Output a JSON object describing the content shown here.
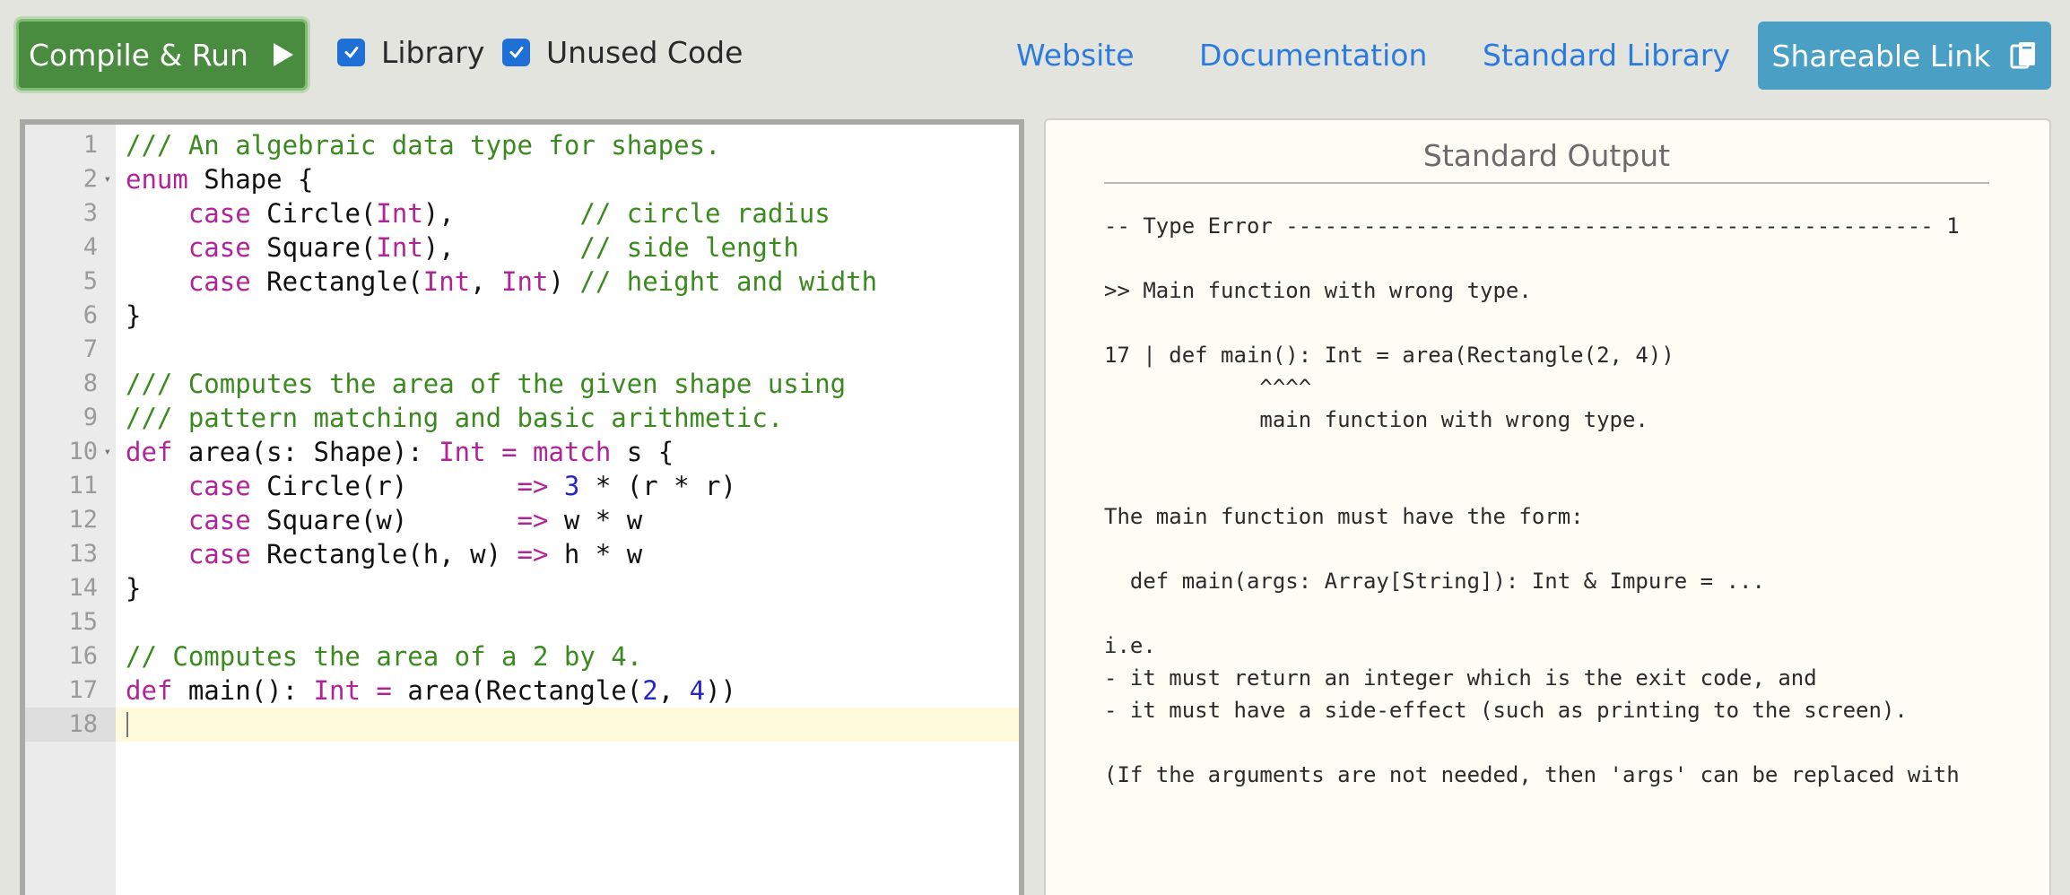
{
  "toolbar": {
    "run_label": "Compile & Run",
    "run_icon": "play-icon",
    "library_label": "Library",
    "library_checked": true,
    "unused_code_label": "Unused Code",
    "unused_code_checked": true,
    "links": [
      "Website",
      "Documentation",
      "Standard Library"
    ],
    "share_label": "Shareable Link",
    "share_icon": "clipboard-icon"
  },
  "editor": {
    "active_line": 18,
    "lines": [
      {
        "n": "1",
        "fold": false,
        "tokens": [
          {
            "t": "/// An algebraic data type for shapes.",
            "c": "comment"
          }
        ]
      },
      {
        "n": "2",
        "fold": true,
        "tokens": [
          {
            "t": "enum",
            "c": "keyword"
          },
          {
            "t": " Shape {",
            "c": "plain"
          }
        ]
      },
      {
        "n": "3",
        "fold": false,
        "tokens": [
          {
            "t": "    ",
            "c": "plain"
          },
          {
            "t": "case",
            "c": "keyword"
          },
          {
            "t": " Circle(",
            "c": "plain"
          },
          {
            "t": "Int",
            "c": "keyword"
          },
          {
            "t": "),        ",
            "c": "plain"
          },
          {
            "t": "// circle radius",
            "c": "comment"
          }
        ]
      },
      {
        "n": "4",
        "fold": false,
        "tokens": [
          {
            "t": "    ",
            "c": "plain"
          },
          {
            "t": "case",
            "c": "keyword"
          },
          {
            "t": " Square(",
            "c": "plain"
          },
          {
            "t": "Int",
            "c": "keyword"
          },
          {
            "t": "),        ",
            "c": "plain"
          },
          {
            "t": "// side length",
            "c": "comment"
          }
        ]
      },
      {
        "n": "5",
        "fold": false,
        "tokens": [
          {
            "t": "    ",
            "c": "plain"
          },
          {
            "t": "case",
            "c": "keyword"
          },
          {
            "t": " Rectangle(",
            "c": "plain"
          },
          {
            "t": "Int",
            "c": "keyword"
          },
          {
            "t": ", ",
            "c": "plain"
          },
          {
            "t": "Int",
            "c": "keyword"
          },
          {
            "t": ") ",
            "c": "plain"
          },
          {
            "t": "// height and width",
            "c": "comment"
          }
        ]
      },
      {
        "n": "6",
        "fold": false,
        "tokens": [
          {
            "t": "}",
            "c": "plain"
          }
        ]
      },
      {
        "n": "7",
        "fold": false,
        "tokens": []
      },
      {
        "n": "8",
        "fold": false,
        "tokens": [
          {
            "t": "/// Computes the area of the given shape using",
            "c": "comment"
          }
        ]
      },
      {
        "n": "9",
        "fold": false,
        "tokens": [
          {
            "t": "/// pattern matching and basic arithmetic.",
            "c": "comment"
          }
        ]
      },
      {
        "n": "10",
        "fold": true,
        "tokens": [
          {
            "t": "def",
            "c": "keyword"
          },
          {
            "t": " area(s: Shape): ",
            "c": "plain"
          },
          {
            "t": "Int",
            "c": "keyword"
          },
          {
            "t": " ",
            "c": "plain"
          },
          {
            "t": "=",
            "c": "keyword"
          },
          {
            "t": " ",
            "c": "plain"
          },
          {
            "t": "match",
            "c": "keyword"
          },
          {
            "t": " s {",
            "c": "plain"
          }
        ]
      },
      {
        "n": "11",
        "fold": false,
        "tokens": [
          {
            "t": "    ",
            "c": "plain"
          },
          {
            "t": "case",
            "c": "keyword"
          },
          {
            "t": " Circle(r)       ",
            "c": "plain"
          },
          {
            "t": "=>",
            "c": "keyword"
          },
          {
            "t": " ",
            "c": "plain"
          },
          {
            "t": "3",
            "c": "number"
          },
          {
            "t": " * (r * r)",
            "c": "plain"
          }
        ]
      },
      {
        "n": "12",
        "fold": false,
        "tokens": [
          {
            "t": "    ",
            "c": "plain"
          },
          {
            "t": "case",
            "c": "keyword"
          },
          {
            "t": " Square(w)       ",
            "c": "plain"
          },
          {
            "t": "=>",
            "c": "keyword"
          },
          {
            "t": " w * w",
            "c": "plain"
          }
        ]
      },
      {
        "n": "13",
        "fold": false,
        "tokens": [
          {
            "t": "    ",
            "c": "plain"
          },
          {
            "t": "case",
            "c": "keyword"
          },
          {
            "t": " Rectangle(h, w) ",
            "c": "plain"
          },
          {
            "t": "=>",
            "c": "keyword"
          },
          {
            "t": " h * w",
            "c": "plain"
          }
        ]
      },
      {
        "n": "14",
        "fold": false,
        "tokens": [
          {
            "t": "}",
            "c": "plain"
          }
        ]
      },
      {
        "n": "15",
        "fold": false,
        "tokens": []
      },
      {
        "n": "16",
        "fold": false,
        "tokens": [
          {
            "t": "// Computes the area of a 2 by 4.",
            "c": "comment"
          }
        ]
      },
      {
        "n": "17",
        "fold": false,
        "tokens": [
          {
            "t": "def",
            "c": "keyword"
          },
          {
            "t": " main(): ",
            "c": "plain"
          },
          {
            "t": "Int",
            "c": "keyword"
          },
          {
            "t": " ",
            "c": "plain"
          },
          {
            "t": "=",
            "c": "keyword"
          },
          {
            "t": " area(Rectangle(",
            "c": "plain"
          },
          {
            "t": "2",
            "c": "number"
          },
          {
            "t": ", ",
            "c": "plain"
          },
          {
            "t": "4",
            "c": "number"
          },
          {
            "t": "))",
            "c": "plain"
          }
        ]
      },
      {
        "n": "18",
        "fold": false,
        "tokens": []
      }
    ]
  },
  "output": {
    "title": "Standard Output",
    "lines": [
      "-- Type Error -------------------------------------------------- 1",
      "",
      ">> Main function with wrong type.",
      "",
      "17 | def main(): Int = area(Rectangle(2, 4))",
      "            ^^^^",
      "            main function with wrong type.",
      "",
      "",
      "The main function must have the form:",
      "",
      "  def main(args: Array[String]): Int & Impure = ...",
      "",
      "i.e.",
      "- it must return an integer which is the exit code, and",
      "- it must have a side-effect (such as printing to the screen).",
      "",
      "(If the arguments are not needed, then 'args' can be replaced with"
    ]
  },
  "colors": {
    "run_button": "#4a8c3f",
    "share_button": "#4a9fc4",
    "link": "#2a7be0",
    "checkbox": "#1e6fd6",
    "comment": "#3b8a20",
    "keyword": "#b0249a",
    "number": "#2826c7",
    "active_line": "#fdfbdc"
  }
}
